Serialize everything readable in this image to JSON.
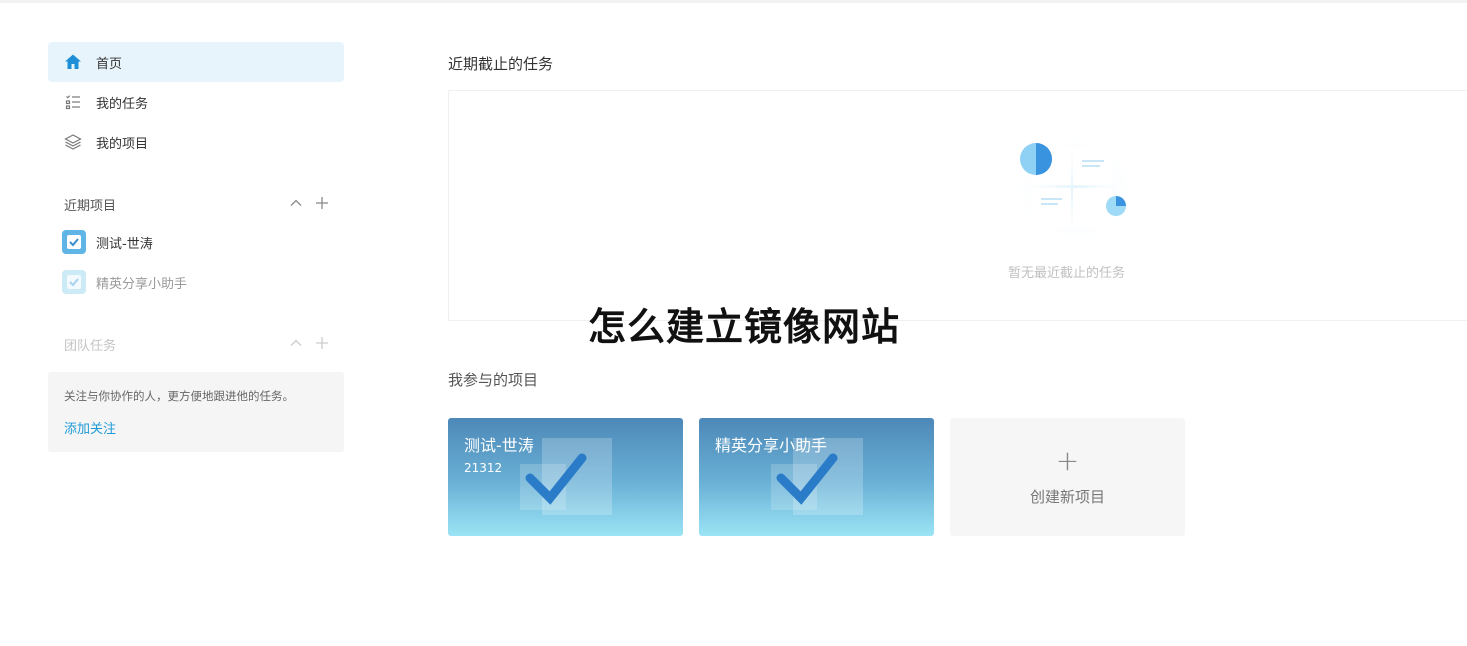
{
  "sidebar": {
    "nav": [
      {
        "label": "首页",
        "icon": "home-icon",
        "active": true
      },
      {
        "label": "我的任务",
        "icon": "task-list-icon",
        "active": false
      },
      {
        "label": "我的项目",
        "icon": "layers-icon",
        "active": false
      }
    ],
    "recent_projects": {
      "title": "近期项目",
      "items": [
        {
          "label": "测试-世涛"
        },
        {
          "label": "精英分享小助手"
        }
      ]
    },
    "team_tasks": {
      "title": "团队任务",
      "hint": "关注与你协作的人，更方便地跟进他的任务。",
      "link": "添加关注"
    }
  },
  "main": {
    "due_tasks": {
      "title": "近期截止的任务",
      "empty_text": "暂无最近截止的任务"
    },
    "overlay_title": "怎么建立镜像网站",
    "projects": {
      "title": "我参与的项目",
      "cards": [
        {
          "name": "测试-世涛",
          "code": "21312"
        },
        {
          "name": "精英分享小助手",
          "code": ""
        }
      ],
      "new_label": "创建新项目",
      "new_plus": "+"
    }
  },
  "colors": {
    "accent": "#1e9ad6",
    "active_bg": "#e8f4fb",
    "card_top": "#4d88b8",
    "card_bottom": "#9be4f5"
  }
}
